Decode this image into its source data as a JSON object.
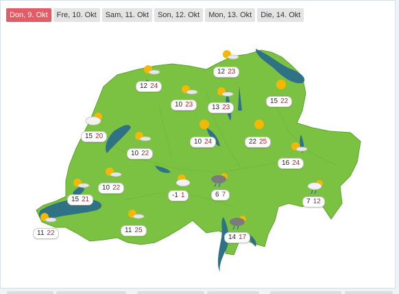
{
  "tabs": [
    {
      "label": "Don, 9. Okt",
      "active": true
    },
    {
      "label": "Fre, 10. Okt",
      "active": false
    },
    {
      "label": "Sam, 11. Okt",
      "active": false
    },
    {
      "label": "Son, 12. Okt",
      "active": false
    },
    {
      "label": "Mon, 13. Okt",
      "active": false
    },
    {
      "label": "Die, 14. Okt",
      "active": false
    }
  ],
  "forecasts": [
    {
      "min": "12",
      "max": "23",
      "icon": "sun-cloud-icon"
    },
    {
      "min": "12",
      "max": "24",
      "icon": "sun-cloud-icon"
    },
    {
      "min": "10",
      "max": "23",
      "icon": "sun-cloud-icon"
    },
    {
      "min": "13",
      "max": "23",
      "icon": "sun-cloud-icon"
    },
    {
      "min": "15",
      "max": "22",
      "icon": "sun-icon"
    },
    {
      "min": "15",
      "max": "20",
      "icon": "cloud-sun-icon"
    },
    {
      "min": "10",
      "max": "22",
      "icon": "sun-cloud-icon"
    },
    {
      "min": "10",
      "max": "24",
      "icon": "sun-icon"
    },
    {
      "min": "22",
      "max": "25",
      "icon": "sun-icon"
    },
    {
      "min": "16",
      "max": "24",
      "icon": "sun-cloud-icon"
    },
    {
      "min": "10",
      "max": "22",
      "icon": "sun-cloud-icon"
    },
    {
      "min": "15",
      "max": "21",
      "icon": "sun-cloud-icon"
    },
    {
      "min": "-1",
      "max": "1",
      "icon": "sun-cloud-icon"
    },
    {
      "min": "6",
      "max": "7",
      "icon": "rain-cloud-icon"
    },
    {
      "min": "7",
      "max": "12",
      "icon": "cloud-rain-sun-icon"
    },
    {
      "min": "11",
      "max": "25",
      "icon": "sun-cloud-icon"
    },
    {
      "min": "11",
      "max": "22",
      "icon": "sun-cloud-icon"
    },
    {
      "min": "14",
      "max": "17",
      "icon": "rain-cloud-icon"
    }
  ],
  "colors": {
    "land": "#7cc242",
    "lake": "#2f7285",
    "accent": "#e35b64",
    "sun": "#f5b800"
  }
}
